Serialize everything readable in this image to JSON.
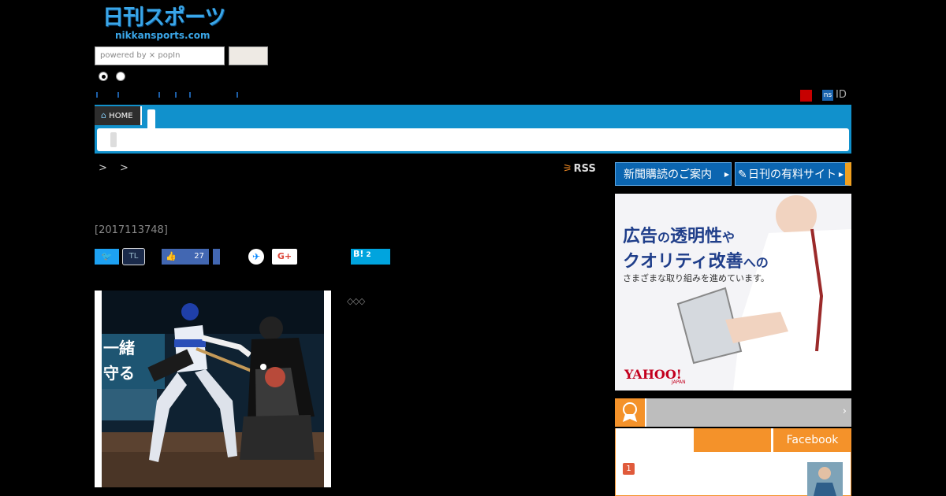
{
  "header": {
    "logo_jp": "日刊スポーツ",
    "logo_en": "nikkansports.com",
    "search_placeholder": "powered by ⨯ popIn"
  },
  "topbar": {
    "ns_badge": "ns",
    "id_label": "ID"
  },
  "nav": {
    "home_label": "HOME"
  },
  "breadcrumb": {
    "text": "> >"
  },
  "rss": {
    "label": "RSS"
  },
  "article": {
    "id": "[2017113748]",
    "diamonds": "◇◇◇"
  },
  "share": {
    "tl_label": "TL",
    "like_count": "27",
    "gplus_label": "G+",
    "hatena_label": "B!",
    "hatena_count": "2"
  },
  "sidebar": {
    "subscribe_label": "新聞購読のご案内",
    "paid_label": "日刊の有料サイト",
    "ad": {
      "line1_a": "広告",
      "line1_b": "の",
      "line1_c": "透明性",
      "line1_d": "や",
      "line2_a": "クオリティ改善",
      "line2_b": "への",
      "line3": "さまざまな取り組みを進めています。",
      "yahoo": "YAHOO!",
      "japan": "JAPAN"
    },
    "ranking": {
      "chevron": "›",
      "facebook_tab": "Facebook",
      "first_rank": "1"
    }
  },
  "colors": {
    "nav_blue": "#1191cc",
    "accent_orange": "#f4922a",
    "button_blue": "#0b65b0"
  }
}
